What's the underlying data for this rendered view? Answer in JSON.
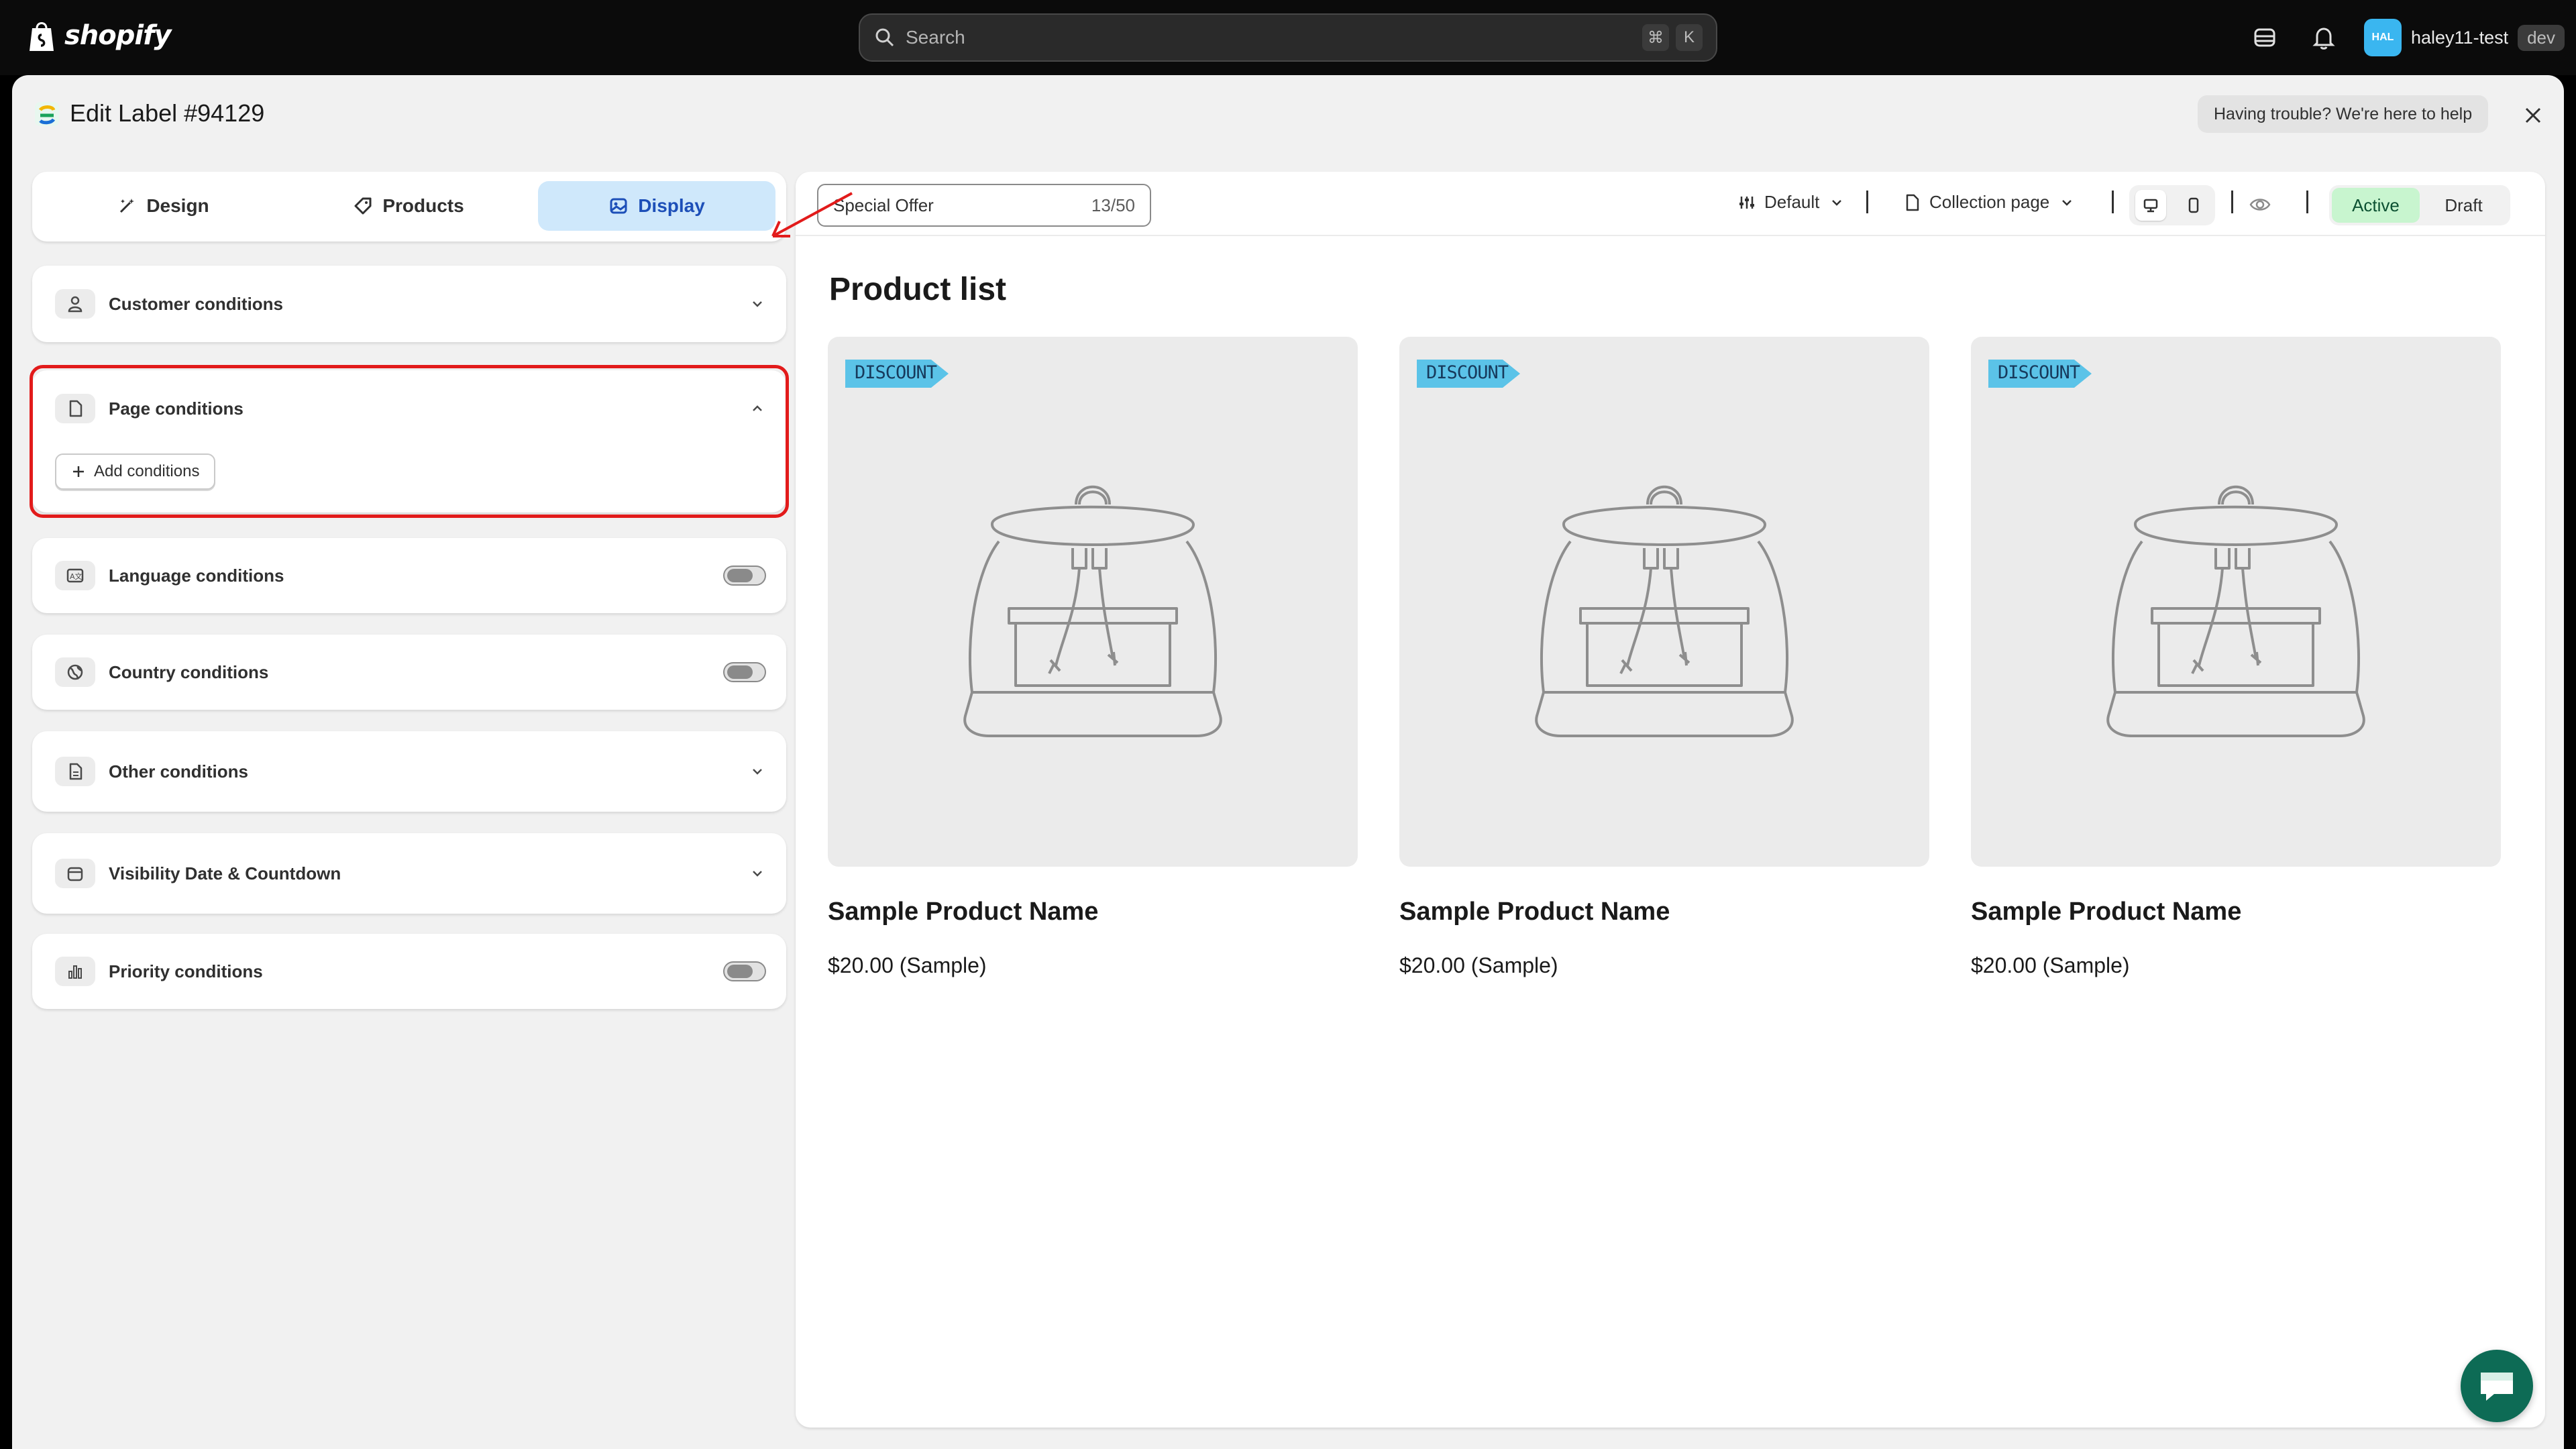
{
  "topbar": {
    "brand": "shopify",
    "search_placeholder": "Search",
    "shortcut_keys": [
      "⌘",
      "K"
    ],
    "user": {
      "initials": "HAL",
      "name": "haley11-test",
      "badge": "dev",
      "avatar_color": "#3ab6f0"
    }
  },
  "window": {
    "title": "Edit Label #94129",
    "help_text": "Having trouble? We're here to help"
  },
  "tabs": [
    {
      "label": "Design",
      "icon": "magic-wand-icon",
      "active": false
    },
    {
      "label": "Products",
      "icon": "tag-icon",
      "active": false
    },
    {
      "label": "Display",
      "icon": "image-icon",
      "active": true
    }
  ],
  "conditions": [
    {
      "label": "Customer conditions",
      "icon": "person-icon",
      "control": "chevron-down"
    },
    {
      "label": "Page conditions",
      "icon": "page-icon",
      "control": "chevron-up",
      "expanded": true,
      "highlighted": true,
      "add_button": "Add conditions"
    },
    {
      "label": "Language conditions",
      "icon": "language-icon",
      "control": "toggle",
      "on": false
    },
    {
      "label": "Country conditions",
      "icon": "globe-icon",
      "control": "toggle",
      "on": false
    },
    {
      "label": "Other conditions",
      "icon": "document-icon",
      "control": "chevron-down"
    },
    {
      "label": "Visibility Date & Countdown",
      "icon": "calendar-icon",
      "control": "chevron-down"
    },
    {
      "label": "Priority conditions",
      "icon": "bar-chart-icon",
      "control": "toggle",
      "on": false
    }
  ],
  "preview_toolbar": {
    "label_name": "Special Offer",
    "char_count": "13/50",
    "style_dropdown": "Default",
    "page_dropdown": "Collection page",
    "status_options": [
      "Active",
      "Draft"
    ],
    "active_status": "Active"
  },
  "preview": {
    "heading": "Product list",
    "products": [
      {
        "badge": "DISCOUNT",
        "name": "Sample Product Name",
        "price": "$20.00 (Sample)"
      },
      {
        "badge": "DISCOUNT",
        "name": "Sample Product Name",
        "price": "$20.00 (Sample)"
      },
      {
        "badge": "DISCOUNT",
        "name": "Sample Product Name",
        "price": "$20.00 (Sample)"
      }
    ]
  },
  "colors": {
    "accent_tab": "#cfe8fb",
    "highlight_border": "#e21b1b",
    "badge": "#5bc3e8",
    "chat": "#0d6b55",
    "active_status": "#c8f5cf"
  }
}
